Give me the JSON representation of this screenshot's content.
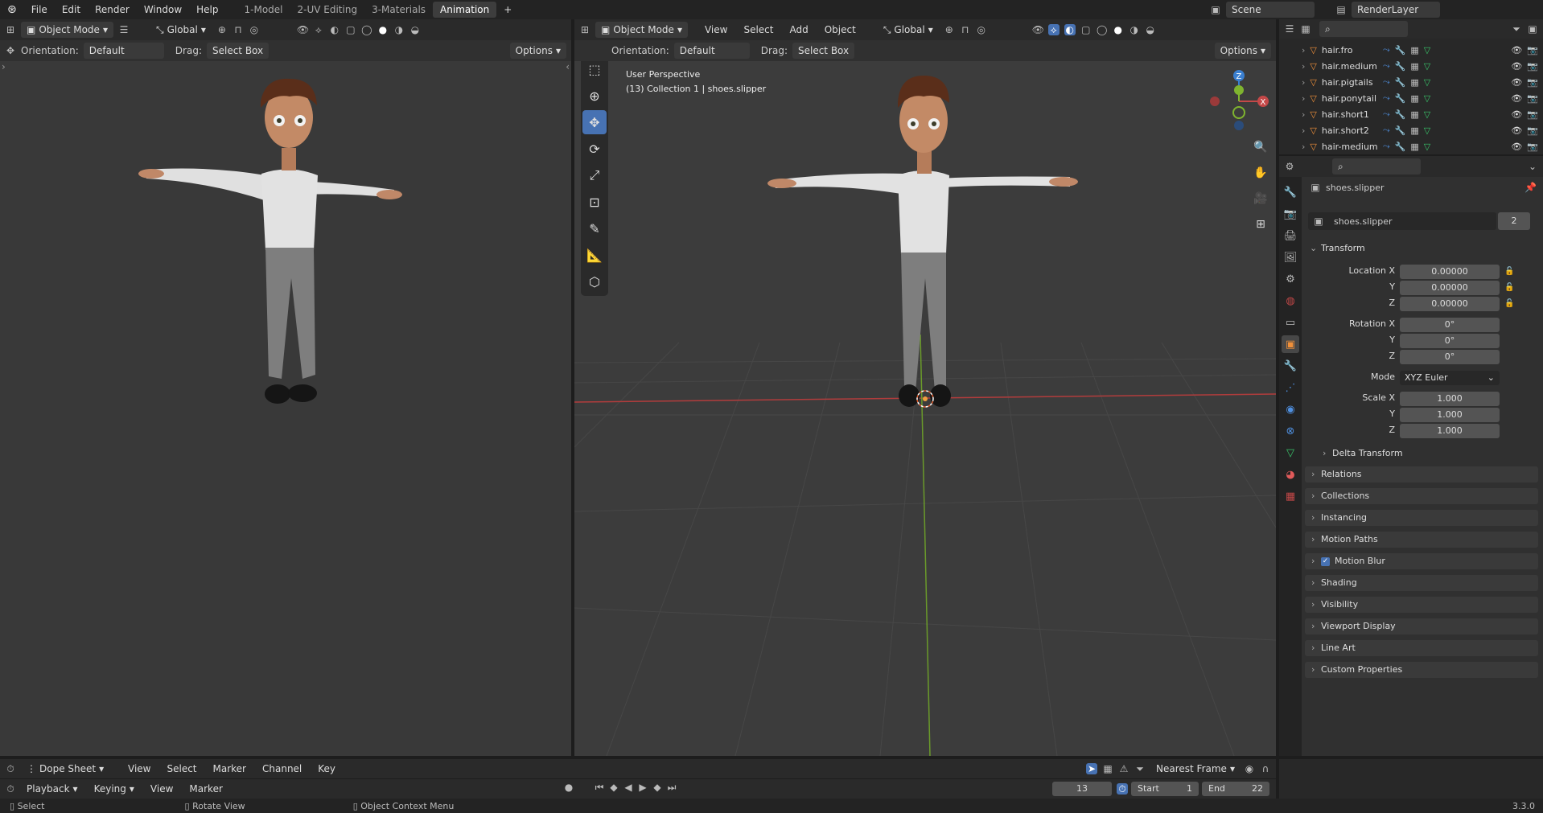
{
  "topbar": {
    "menus": [
      "File",
      "Edit",
      "Render",
      "Window",
      "Help"
    ],
    "workspaces": [
      "1-Model",
      "2-UV Editing",
      "3-Materials",
      "Animation"
    ],
    "active_workspace": "Animation",
    "scene": "Scene",
    "render_layer": "RenderLayer"
  },
  "left_view": {
    "mode": "Object Mode",
    "transform": "Global",
    "orientation_label": "Orientation:",
    "orientation_value": "Default",
    "drag_label": "Drag:",
    "drag_value": "Select Box",
    "options": "Options"
  },
  "main_view": {
    "mode": "Object Mode",
    "menus": [
      "View",
      "Select",
      "Add",
      "Object"
    ],
    "transform": "Global",
    "orientation_label": "Orientation:",
    "orientation_value": "Default",
    "drag_label": "Drag:",
    "drag_value": "Select Box",
    "options": "Options",
    "overlay_title": "User Perspective",
    "overlay_sub": "(13) Collection 1 | shoes.slipper"
  },
  "outliner": {
    "items": [
      "hair.fro",
      "hair.medium",
      "hair.pigtails",
      "hair.ponytail",
      "hair.short1",
      "hair.short2",
      "hair-medium"
    ]
  },
  "properties": {
    "object_name": "shoes.slipper",
    "datablock": "shoes.slipper",
    "users": "2",
    "transform_header": "Transform",
    "location_label": "Location X",
    "location": [
      "0.00000",
      "0.00000",
      "0.00000"
    ],
    "rotation_label": "Rotation X",
    "rotation": [
      "0°",
      "0°",
      "0°"
    ],
    "mode_label": "Mode",
    "mode_value": "XYZ Euler",
    "scale_label": "Scale X",
    "scale": [
      "1.000",
      "1.000",
      "1.000"
    ],
    "axis_y": "Y",
    "axis_z": "Z",
    "delta": "Delta Transform",
    "panels": [
      "Relations",
      "Collections",
      "Instancing",
      "Motion Paths",
      "Motion Blur",
      "Shading",
      "Visibility",
      "Viewport Display",
      "Line Art",
      "Custom Properties"
    ]
  },
  "dopesheet": {
    "editor": "Dope Sheet",
    "menus": [
      "View",
      "Select",
      "Marker",
      "Channel",
      "Key"
    ],
    "snap": "Nearest Frame"
  },
  "timeline": {
    "playback": "Playback",
    "keying": "Keying",
    "view": "View",
    "marker": "Marker",
    "current_frame": "13",
    "start_label": "Start",
    "start": "1",
    "end_label": "End",
    "end": "22"
  },
  "status": {
    "select": "Select",
    "rotate": "Rotate View",
    "context": "Object Context Menu",
    "version": "3.3.0"
  },
  "colors": {
    "accent": "#4772b3",
    "x_axis": "#c44848",
    "y_axis": "#7fb42f",
    "z_axis": "#3a7fd0"
  }
}
